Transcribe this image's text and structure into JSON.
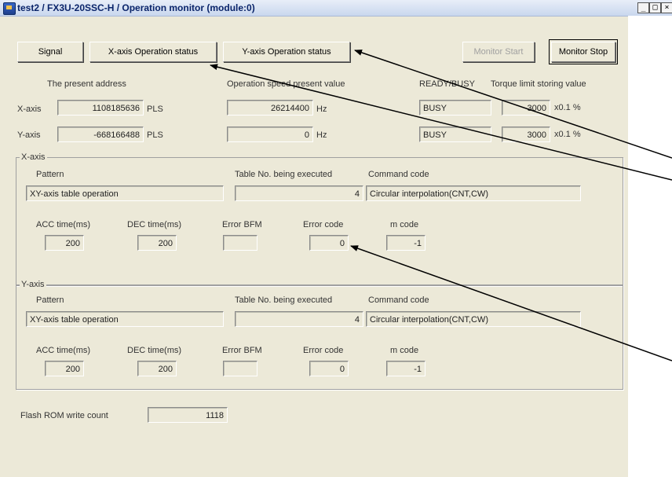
{
  "window": {
    "title": "test2 / FX3U-20SSC-H / Operation monitor (module:0)",
    "controls": [
      "_",
      "□",
      "×"
    ]
  },
  "toolbar": {
    "signal": "Signal",
    "x_status": "X-axis Operation status",
    "y_status": "Y-axis Operation status",
    "monitor_start": "Monitor Start",
    "monitor_stop": "Monitor Stop"
  },
  "headers": {
    "present_address": "The present address",
    "speed": "Operation speed present value",
    "ready_busy": "READY/BUSY",
    "torque": "Torque limit storing value"
  },
  "status_rows": [
    {
      "axis": "X-axis",
      "address": "1108185636",
      "address_unit": "PLS",
      "speed": "26214400",
      "speed_unit": "Hz",
      "ready": "BUSY",
      "torque": "3000",
      "torque_unit": "x0.1 %"
    },
    {
      "axis": "Y-axis",
      "address": "-668166488",
      "address_unit": "PLS",
      "speed": "0",
      "speed_unit": "Hz",
      "ready": "BUSY",
      "torque": "3000",
      "torque_unit": "x0.1 %"
    }
  ],
  "groups": [
    {
      "title": "X-axis",
      "pattern_label": "Pattern",
      "pattern": "XY-axis table operation",
      "table_label": "Table No. being executed",
      "table_no": "4",
      "command_label": "Command code",
      "command": "Circular interpolation(CNT,CW)",
      "acc_label": "ACC time(ms)",
      "acc": "200",
      "dec_label": "DEC time(ms)",
      "dec": "200",
      "err_bfm_label": "Error BFM",
      "err_bfm": "",
      "err_code_label": "Error code",
      "err_code": "0",
      "m_label": "m code",
      "m_code": "-1"
    },
    {
      "title": "Y-axis",
      "pattern_label": "Pattern",
      "pattern": "XY-axis table operation",
      "table_label": "Table No. being executed",
      "table_no": "4",
      "command_label": "Command code",
      "command": "Circular interpolation(CNT,CW)",
      "acc_label": "ACC time(ms)",
      "acc": "200",
      "dec_label": "DEC time(ms)",
      "dec": "200",
      "err_bfm_label": "Error BFM",
      "err_bfm": "",
      "err_code_label": "Error code",
      "err_code": "0",
      "m_label": "m code",
      "m_code": "-1"
    }
  ],
  "flash": {
    "label": "Flash ROM write count",
    "value": "1118"
  },
  "colors": {
    "window_bg": "#ece9d8",
    "title_text": "#0a246a",
    "annotation": "#000000"
  }
}
